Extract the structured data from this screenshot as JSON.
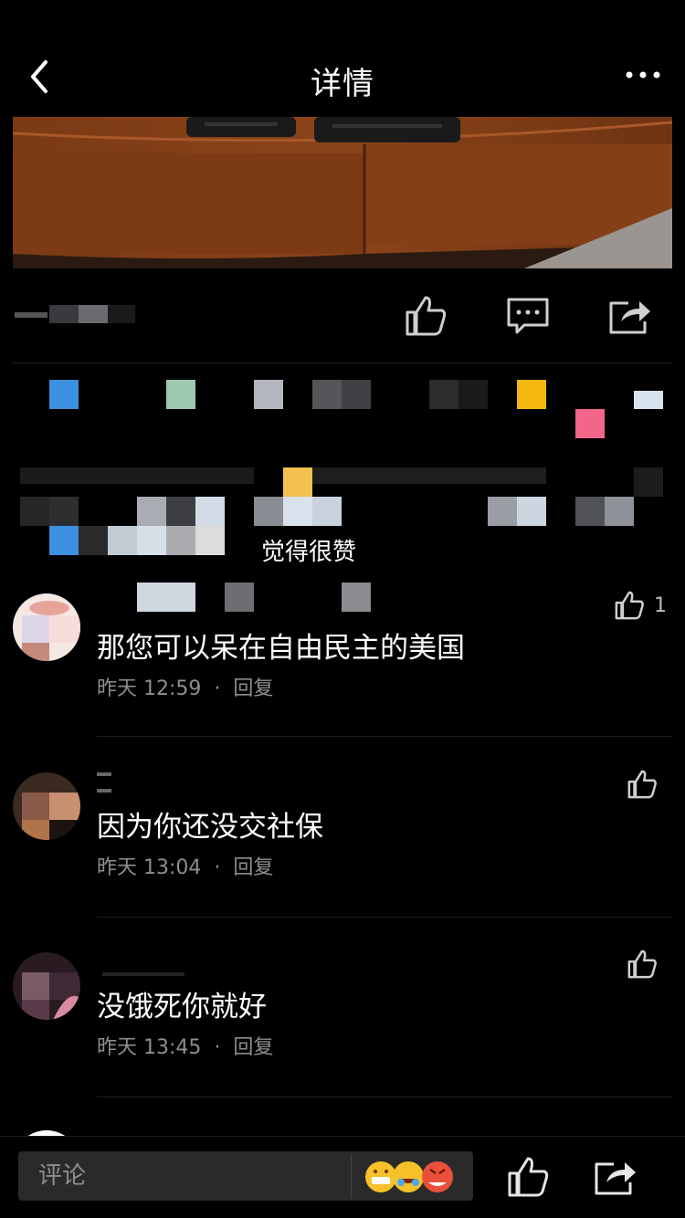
{
  "nav": {
    "title": "详情",
    "back_icon": "chevron-left-icon",
    "more_icon": "more-dots-icon"
  },
  "actions": {
    "like_icon": "thumbs-up-icon",
    "comment_icon": "comment-bubble-icon",
    "share_icon": "share-icon"
  },
  "likers": {
    "suffix": "觉得很赞"
  },
  "comments": [
    {
      "text": "那您可以呆在自由民主的美国",
      "time": "昨天 12:59",
      "separator": "·",
      "reply": "回复",
      "likes": "1"
    },
    {
      "text": "因为你还没交社保",
      "time": "昨天 13:04",
      "separator": "·",
      "reply": "回复",
      "likes": ""
    },
    {
      "text": "没饿死你就好",
      "time": "昨天 13:45",
      "separator": "·",
      "reply": "回复",
      "likes": ""
    }
  ],
  "bottom": {
    "comment_placeholder": "评论",
    "emoji_icon": "emoji-picker-icon",
    "like_icon": "thumbs-up-icon",
    "share_icon": "share-icon"
  },
  "colors": {
    "background": "#000000",
    "secondary_text": "#8e8e8e",
    "icon": "#cfcfcf"
  }
}
